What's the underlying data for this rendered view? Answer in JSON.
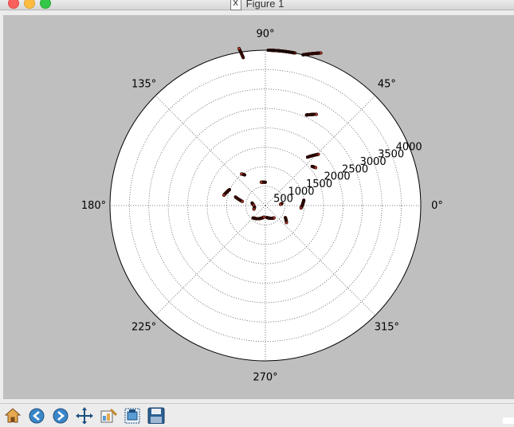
{
  "window": {
    "title": "Figure 1",
    "logo_glyph": "X"
  },
  "toolbar": {
    "buttons": [
      {
        "name": "home-icon"
      },
      {
        "name": "back-icon"
      },
      {
        "name": "forward-icon"
      },
      {
        "name": "pan-icon"
      },
      {
        "name": "configure-subplots-icon"
      },
      {
        "name": "zoom-to-rect-icon"
      },
      {
        "name": "save-icon"
      }
    ]
  },
  "colors": {
    "figure_background": "#bfbfbf",
    "axes_background": "#ffffff",
    "marker_edge": "#2a0a04",
    "marker_fill": "#c0392b"
  },
  "chart_data": {
    "type": "scatter",
    "projection": "polar",
    "theta_unit": "degrees",
    "theta_ticks": [
      0,
      45,
      90,
      135,
      180,
      225,
      270,
      315
    ],
    "theta_tick_labels": [
      "0°",
      "45°",
      "90°",
      "135°",
      "180°",
      "225°",
      "270°",
      "315°"
    ],
    "r_ticks": [
      500,
      1000,
      1500,
      2000,
      2500,
      3000,
      3500,
      4000
    ],
    "r_tick_labels": [
      "500",
      "1000",
      "1500",
      "2000",
      "2500",
      "3000",
      "3500",
      "4000"
    ],
    "rlim": [
      0,
      4000
    ],
    "grid": true,
    "segments": [
      {
        "theta": [
          98.5,
          99.5
        ],
        "r": [
          3850,
          4100
        ]
      },
      {
        "theta": [
          89,
          79
        ],
        "r": [
          4000,
          4000
        ]
      },
      {
        "theta": [
          76,
          70
        ],
        "r": [
          4000,
          4180
        ]
      },
      {
        "theta": [
          65.6,
          60.8
        ],
        "r": [
          2560,
          2690
        ]
      },
      {
        "theta": [
          49,
          44
        ],
        "r": [
          1650,
          1900
        ]
      },
      {
        "theta": [
          40,
          37
        ],
        "r": [
          1570,
          1620
        ]
      },
      {
        "theta": [
          8,
          -4
        ],
        "r": [
          1000,
          920
        ]
      },
      {
        "theta": [
          -31,
          -39
        ],
        "r": [
          600,
          700
        ]
      },
      {
        "theta": [
          7.4,
          4.2
        ],
        "r": [
          430,
          390
        ]
      },
      {
        "theta": [
          90,
          100
        ],
        "r": [
          600,
          610
        ]
      },
      {
        "theta": [
          124,
          127
        ],
        "r": [
          950,
          1020
        ]
      },
      {
        "theta": [
          156,
          166
        ],
        "r": [
          1010,
          1100
        ]
      },
      {
        "theta": [
          164,
          170
        ],
        "r": [
          800,
          600
        ]
      },
      {
        "theta": [
          169,
          178
        ],
        "r": [
          350,
          300
        ]
      },
      {
        "theta": [
          188,
          198
        ],
        "r": [
          280,
          310
        ]
      },
      {
        "theta": [
          -135,
          -97
        ],
        "r": [
          450,
          300
        ]
      },
      {
        "theta": [
          -83,
          -55
        ],
        "r": [
          310,
          390
        ]
      }
    ]
  }
}
